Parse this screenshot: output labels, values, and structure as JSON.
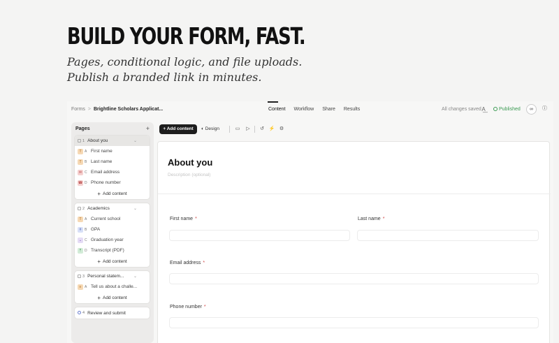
{
  "hero": {
    "title": "BUILD YOUR FORM, FAST.",
    "subtitle_line1": "Pages, conditional logic, and file uploads.",
    "subtitle_line2": "Publish a branded link in minutes."
  },
  "topbar": {
    "breadcrumb_root": "Forms",
    "breadcrumb_sep": ">",
    "breadcrumb_current": "Brightline Scholars Applicat...",
    "tabs": [
      "Content",
      "Workflow",
      "Share",
      "Results"
    ],
    "save_status": "All changes saved",
    "publish_status": "Published"
  },
  "sidebar": {
    "title": "Pages",
    "add_label": "+",
    "groups": [
      {
        "num": "1",
        "title": "About you",
        "fields": [
          {
            "icon": "T",
            "letter": "A",
            "label": "First name"
          },
          {
            "icon": "T",
            "letter": "B",
            "label": "Last name"
          },
          {
            "icon": "✉",
            "letter": "C",
            "label": "Email address"
          },
          {
            "icon": "☎",
            "letter": "D",
            "label": "Phone number"
          }
        ]
      },
      {
        "num": "2",
        "title": "Academics",
        "fields": [
          {
            "icon": "T",
            "letter": "A",
            "label": "Current school"
          },
          {
            "icon": "#",
            "letter": "B",
            "label": "GPA"
          },
          {
            "icon": "⌄",
            "letter": "C",
            "label": "Graduation year"
          },
          {
            "icon": "⤒",
            "letter": "D",
            "label": "Transcript (PDF)"
          }
        ]
      },
      {
        "num": "3",
        "title": "Personal statem...",
        "fields": [
          {
            "icon": "≡",
            "letter": "A",
            "label": "Tell us about a challe..."
          }
        ]
      },
      {
        "num": "4",
        "title": "Review and submit",
        "fields": []
      }
    ],
    "add_content_label": "Add content"
  },
  "toolbar": {
    "add_content": "Add content",
    "design": "Design"
  },
  "form": {
    "title": "About you",
    "description_placeholder": "Description (optional)",
    "fields": {
      "first_name": "First name",
      "last_name": "Last name",
      "email": "Email address",
      "phone": "Phone number"
    },
    "required_mark": "*"
  },
  "colors": {
    "published_green": "#3a9a52",
    "required_red": "#d04848",
    "text_badge": "#f6d9b5",
    "email_badge": "#f5d0cf",
    "number_badge": "#d8e0f7",
    "choice_badge": "#e5dcf5",
    "upload_badge": "#d3ecd8"
  }
}
